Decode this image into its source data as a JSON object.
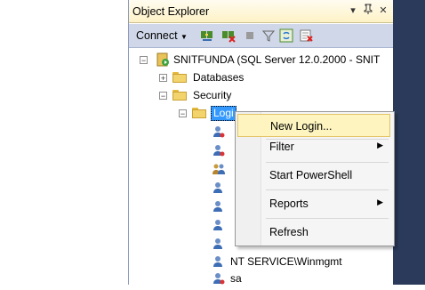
{
  "panel": {
    "title": "Object Explorer",
    "controls": {
      "pin": "▾",
      "autohide": "Ꝋ",
      "close": "✕"
    }
  },
  "toolbar": {
    "connect_label": "Connect",
    "icons": [
      "connect-icon",
      "disconnect-icon",
      "stop-icon",
      "filter-icon",
      "refresh-icon",
      "activity-icon"
    ]
  },
  "tree": {
    "server": "SNITFUNDA (SQL Server 12.0.2000 - SNIT",
    "databases": "Databases",
    "security": "Security",
    "logins_prefix": "Logi",
    "users": [
      {
        "label": ""
      },
      {
        "label": ""
      },
      {
        "label": ""
      },
      {
        "label": ""
      },
      {
        "label": ""
      },
      {
        "label": ""
      },
      {
        "label": ""
      },
      {
        "label": "NT SERVICE\\Winmgmt"
      },
      {
        "label": "sa"
      }
    ]
  },
  "context_menu": {
    "items": [
      {
        "label": "New Login...",
        "submenu": false,
        "highlighted": true
      },
      {
        "label": "Filter",
        "submenu": true
      },
      {
        "label": "Start PowerShell",
        "submenu": false
      },
      {
        "label": "Reports",
        "submenu": true
      },
      {
        "label": "Refresh",
        "submenu": false
      }
    ]
  }
}
